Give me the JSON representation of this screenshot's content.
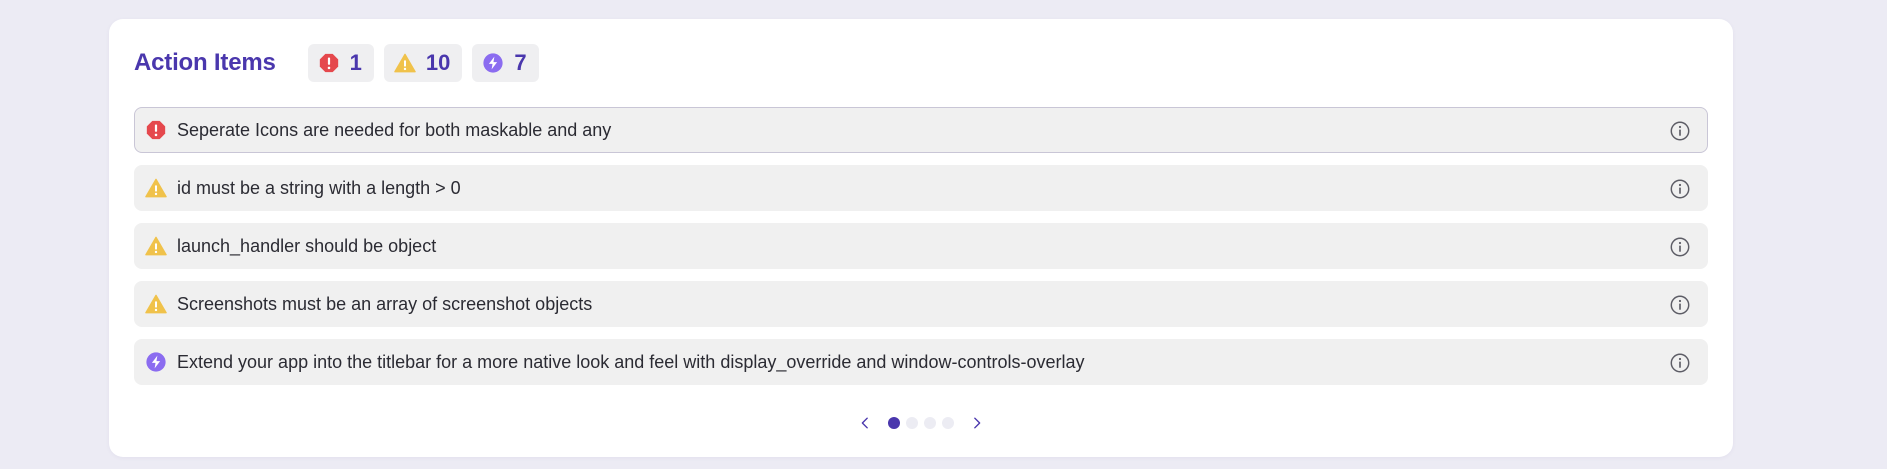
{
  "section": {
    "title": "Action Items"
  },
  "badges": [
    {
      "icon": "error-icon",
      "count": "1"
    },
    {
      "icon": "warning-icon",
      "count": "10"
    },
    {
      "icon": "lightning-icon",
      "count": "7"
    }
  ],
  "items": [
    {
      "type": "error",
      "icon": "error-icon",
      "text": "Seperate Icons are needed for both maskable and any",
      "selected": true
    },
    {
      "type": "warning",
      "icon": "warning-icon",
      "text": "id must be a string with a length > 0"
    },
    {
      "type": "warning",
      "icon": "warning-icon",
      "text": "launch_handler should be object"
    },
    {
      "type": "warning",
      "icon": "warning-icon",
      "text": "Screenshots must be an array of screenshot objects"
    },
    {
      "type": "suggestion",
      "icon": "lightning-icon",
      "text": "Extend your app into the titlebar for a more native look and feel with display_override and window-controls-overlay"
    }
  ],
  "pagination": {
    "pages": 4,
    "current_page": 1
  },
  "colors": {
    "accent": "#4a37ad",
    "error": "#e5484d",
    "warning": "#f0c24b",
    "suggestion": "#8b6cf0"
  }
}
